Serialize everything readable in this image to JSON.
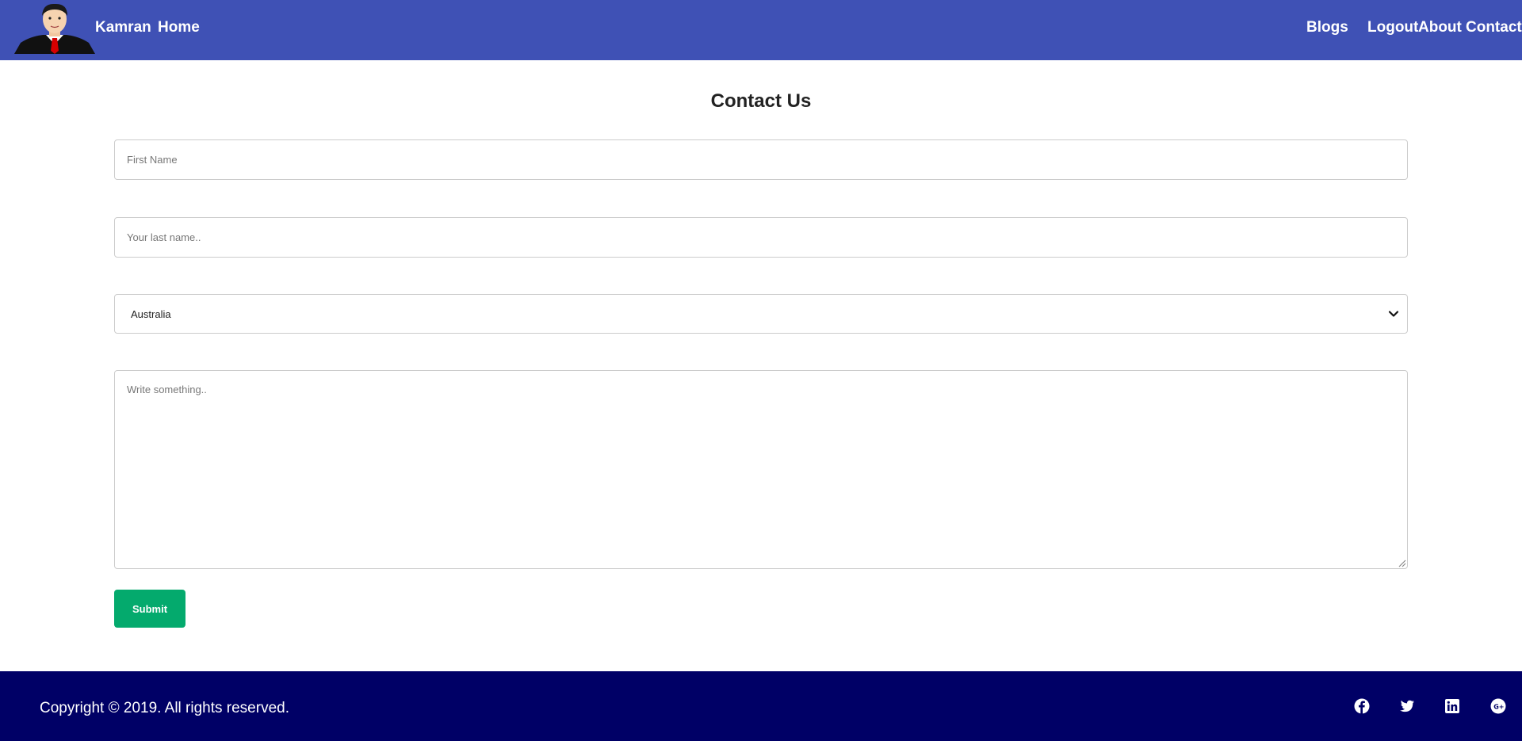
{
  "header": {
    "brand": "Kamran",
    "nav_left": {
      "home": "Home"
    },
    "nav_right": {
      "blogs": "Blogs",
      "logout": "Logout",
      "about": "About",
      "contact": "Contact"
    },
    "bg_color": "#3f51b5"
  },
  "main": {
    "title": "Contact Us",
    "form": {
      "first_name_placeholder": "First Name",
      "last_name_placeholder": "Your last name..",
      "country_selected": "Australia",
      "message_placeholder": "Write something..",
      "submit_label": "Submit",
      "submit_color": "#04aa6d"
    }
  },
  "footer": {
    "copyright": "Copyright © 2019. All rights reserved.",
    "social_icons": [
      "facebook-icon",
      "twitter-icon",
      "linkedin-icon",
      "google-plus-icon"
    ],
    "bg_color": "#000066"
  }
}
